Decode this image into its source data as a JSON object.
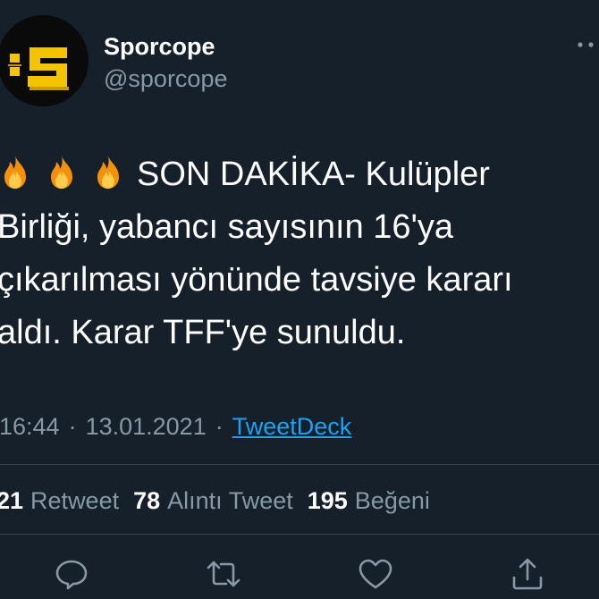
{
  "author": {
    "avatar_label": ":S",
    "display_name": "Sporcope",
    "handle": "@sporcope"
  },
  "tweet": {
    "lines": [
      "SON DAKİKA- Kulüpler",
      "Birliği, yabancı sayısının 16'ya",
      "çıkarılması yönünde tavsiye kararı",
      "aldı. Karar TFF'ye sunuldu."
    ],
    "emoji": [
      "fire-emoji",
      "fire-emoji",
      "fire-emoji"
    ]
  },
  "meta": {
    "time": "16:44",
    "date": "13.01.2021",
    "separator": "·",
    "source": "TweetDeck"
  },
  "stats": {
    "retweets": {
      "count": "21",
      "label": "Retweet"
    },
    "quotes": {
      "count": "78",
      "label": "Alıntı Tweet"
    },
    "likes": {
      "count": "195",
      "label": "Beğeni"
    }
  },
  "actions": [
    "reply-icon",
    "retweet-icon",
    "like-icon",
    "share-icon"
  ],
  "colors": {
    "background": "#15202b",
    "text": "#ffffff",
    "secondary": "#8899a6",
    "link": "#1da1f2",
    "divider": "#38444d",
    "avatar_bg": "#0a0a0a",
    "avatar_logo": "#f5c400"
  }
}
